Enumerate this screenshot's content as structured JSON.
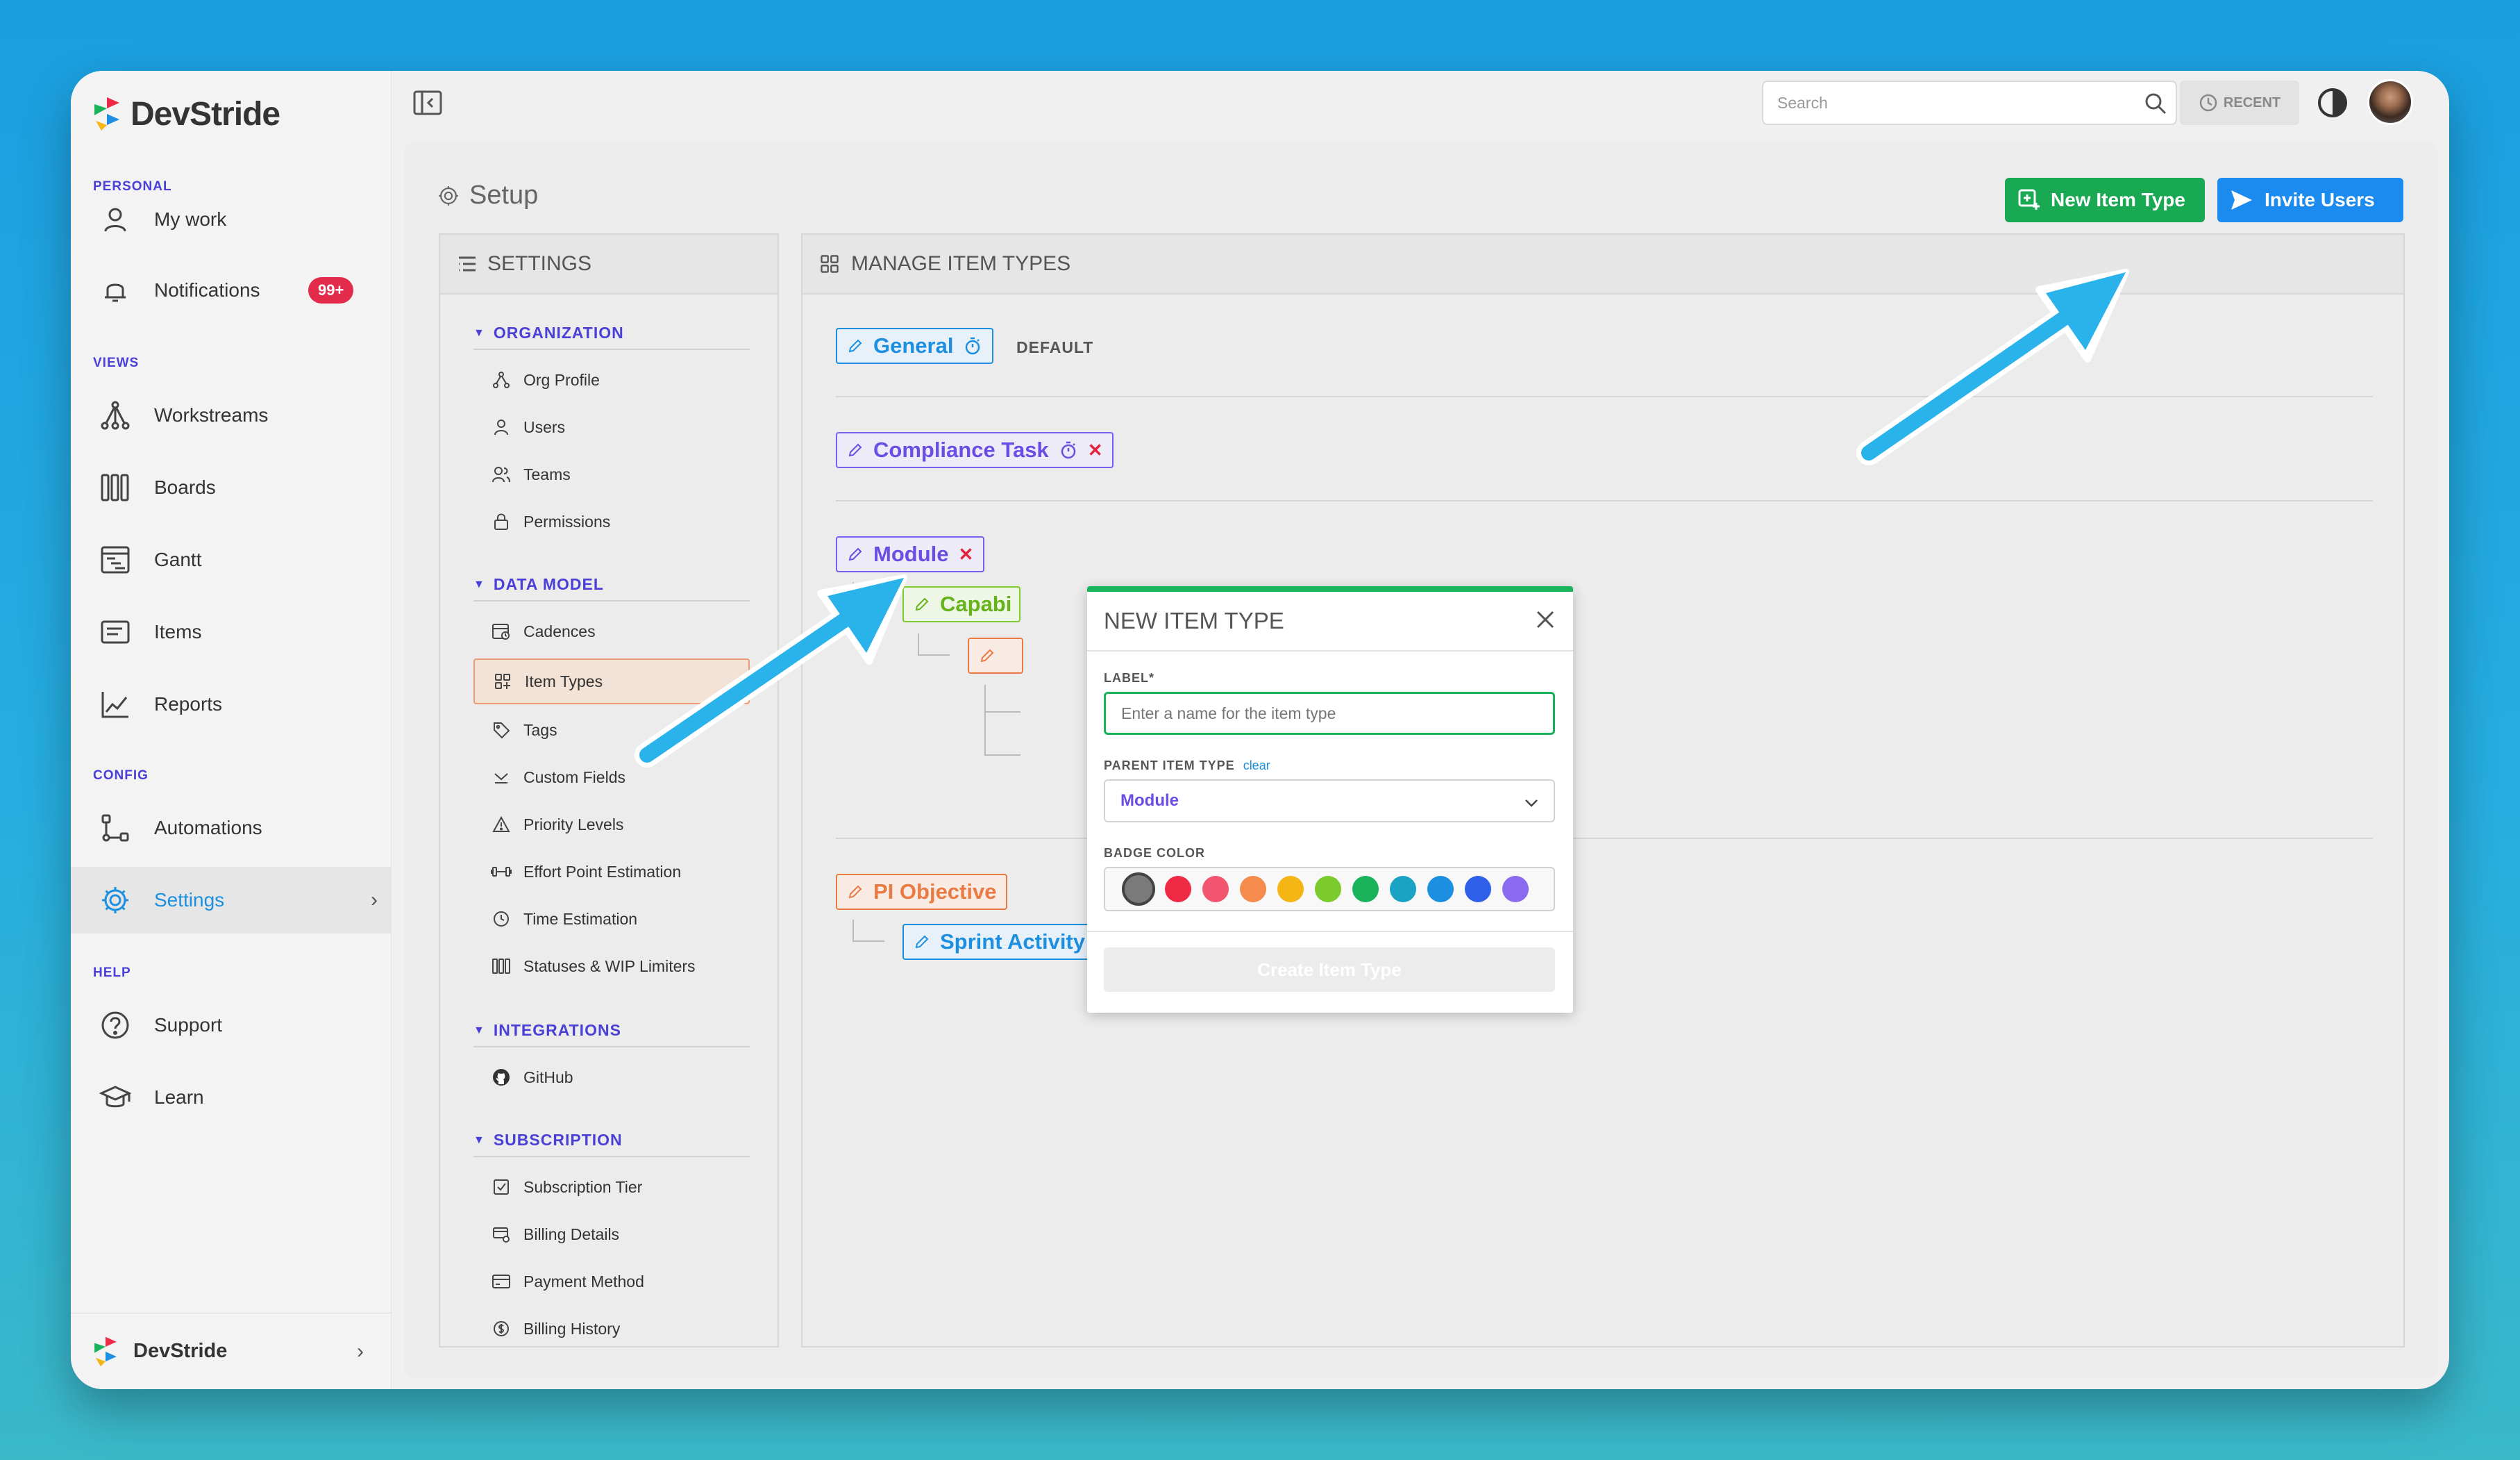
{
  "brand": {
    "name": "DevStride"
  },
  "sidebar": {
    "sections": {
      "personal": "PERSONAL",
      "views": "VIEWS",
      "config": "CONFIG",
      "help": "HELP"
    },
    "items": [
      {
        "label": "My work",
        "icon": "user-icon"
      },
      {
        "label": "Notifications",
        "icon": "bell-icon",
        "badge": "99+"
      },
      {
        "label": "Workstreams",
        "icon": "workstreams-icon"
      },
      {
        "label": "Boards",
        "icon": "boards-icon"
      },
      {
        "label": "Gantt",
        "icon": "gantt-icon"
      },
      {
        "label": "Items",
        "icon": "items-icon"
      },
      {
        "label": "Reports",
        "icon": "reports-icon"
      },
      {
        "label": "Automations",
        "icon": "automations-icon"
      },
      {
        "label": "Settings",
        "icon": "gear-icon",
        "active": true
      },
      {
        "label": "Support",
        "icon": "help-circle-icon"
      },
      {
        "label": "Learn",
        "icon": "graduation-cap-icon"
      }
    ],
    "footer": {
      "label": "DevStride"
    }
  },
  "topbar": {
    "search_placeholder": "Search",
    "recent_label": "RECENT"
  },
  "page": {
    "title": "Setup",
    "new_item_type_label": "New Item Type",
    "invite_users_label": "Invite Users"
  },
  "settings_panel": {
    "title": "SETTINGS",
    "groups": [
      {
        "label": "ORGANIZATION",
        "items": [
          "Org Profile",
          "Users",
          "Teams",
          "Permissions"
        ]
      },
      {
        "label": "DATA MODEL",
        "items": [
          "Cadences",
          "Item Types",
          "Tags",
          "Custom Fields",
          "Priority Levels",
          "Effort Point Estimation",
          "Time Estimation",
          "Statuses & WIP Limiters"
        ]
      },
      {
        "label": "INTEGRATIONS",
        "items": [
          "GitHub"
        ]
      },
      {
        "label": "SUBSCRIPTION",
        "items": [
          "Subscription Tier",
          "Billing Details",
          "Payment Method",
          "Billing History"
        ]
      }
    ],
    "selected_item": "Item Types"
  },
  "manage_panel": {
    "title": "MANAGE ITEM TYPES",
    "default_label": "DEFAULT",
    "types": [
      {
        "label": "General",
        "color": "#1c8fe0",
        "default": true
      },
      {
        "label": "Compliance Task",
        "color": "#7b5cf0"
      },
      {
        "label": "Module",
        "color": "#7b5cf0"
      },
      {
        "label": "Capabi",
        "color": "#7ccb2e"
      },
      {
        "label": "PI Objective",
        "color": "#ea7a44"
      },
      {
        "label": "Sprint Activity",
        "color": "#1c8fe0"
      }
    ]
  },
  "modal": {
    "title": "NEW ITEM TYPE",
    "label_field": {
      "label": "LABEL*",
      "placeholder": "Enter a name for the item type",
      "value": ""
    },
    "parent_field": {
      "label": "PARENT ITEM TYPE",
      "clear_label": "clear",
      "value": "Module"
    },
    "badge_color": {
      "label": "BADGE COLOR",
      "options": [
        "#7a7a7a",
        "#ee2a44",
        "#f2566e",
        "#f58b4c",
        "#f5b514",
        "#7ccb2e",
        "#18b35a",
        "#1aa3c4",
        "#1c8fe0",
        "#2f5ee8",
        "#8b6af0"
      ],
      "selected": "#7a7a7a"
    },
    "create_label": "Create Item Type"
  },
  "colors": {
    "accent_green": "#18a952",
    "accent_blue": "#1b8bef",
    "brand_purple": "#4a3fd6",
    "arrow": "#2ab3ea"
  }
}
